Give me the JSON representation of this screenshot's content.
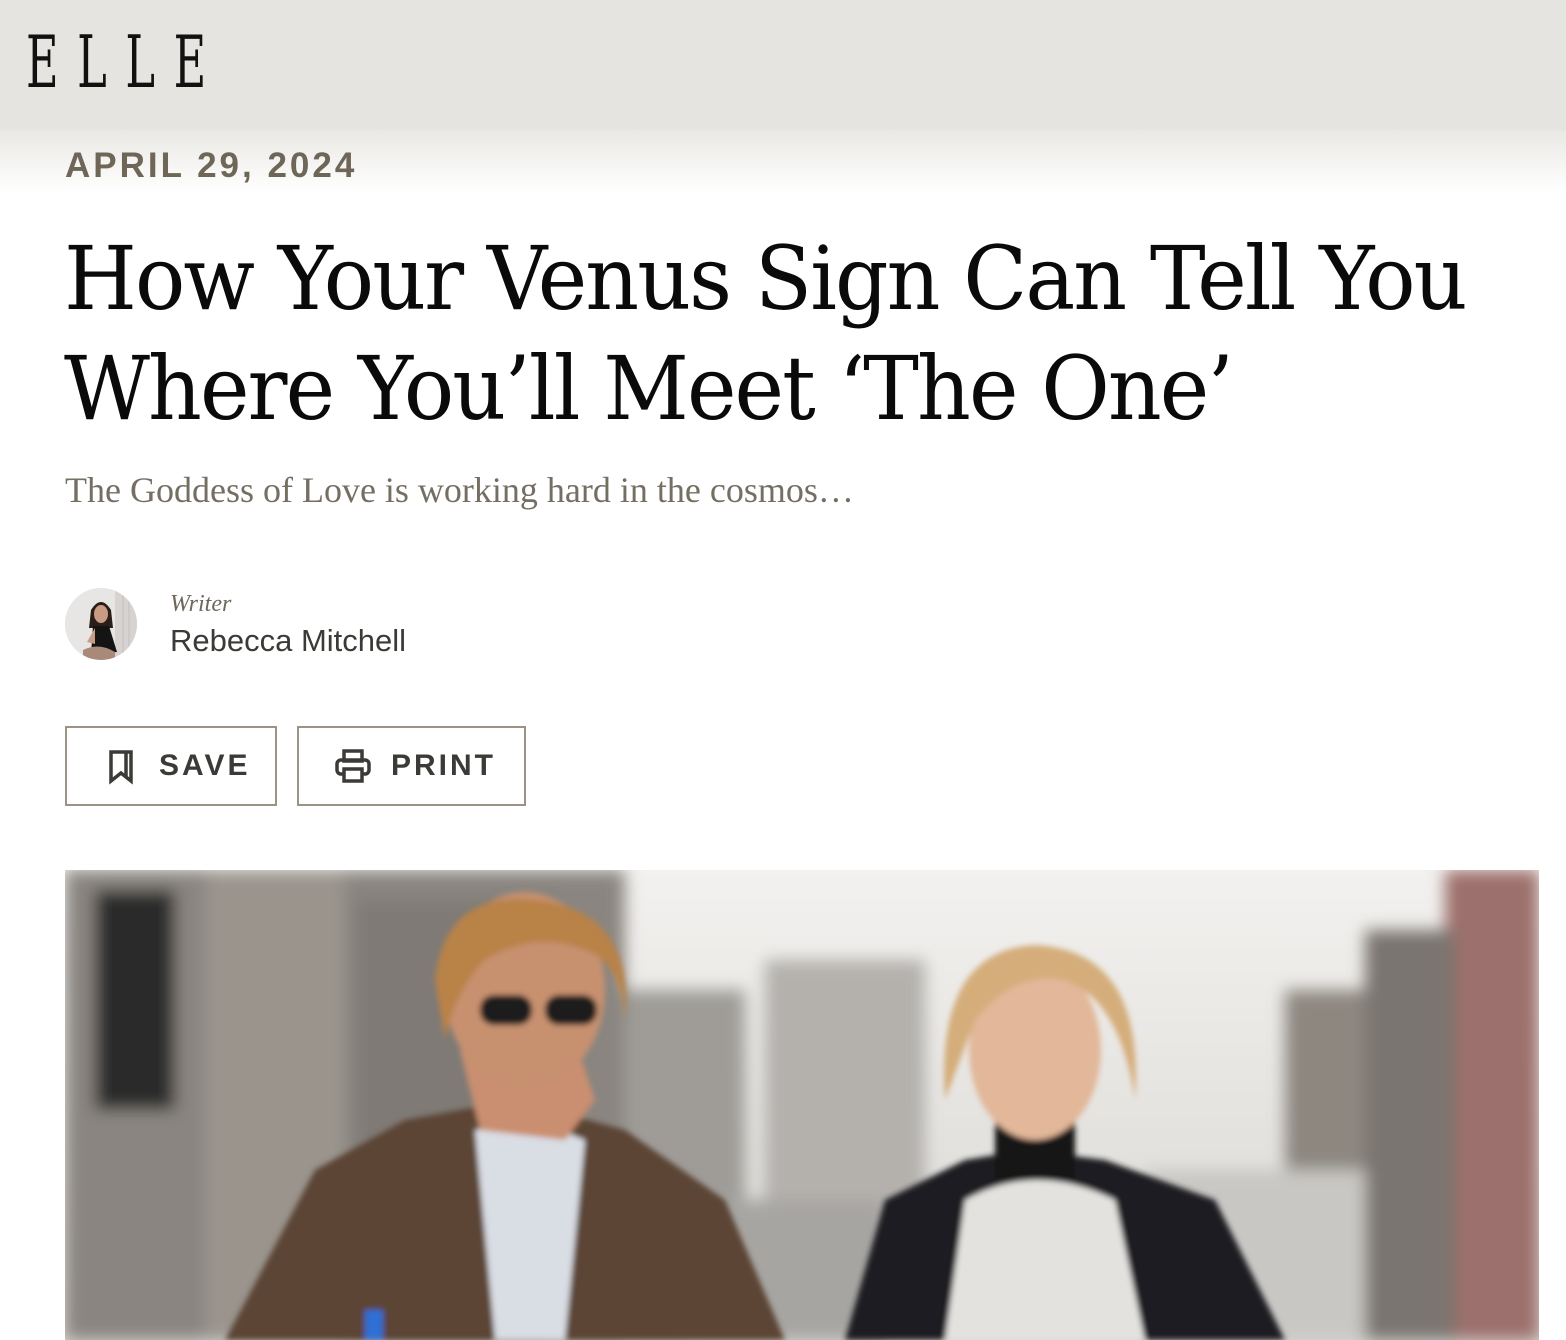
{
  "site": {
    "logo_text": "ELLE"
  },
  "article": {
    "date": "APRIL 29, 2024",
    "headline": "How Your Venus Sign Can Tell You Where You’ll Meet ‘The One’",
    "dek": "The Goddess of Love is working hard in the cosmos…",
    "byline": {
      "role": "Writer",
      "author": "Rebecca Mitchell"
    }
  },
  "actions": {
    "save_label": "SAVE",
    "save_icon": "bookmark-icon",
    "print_label": "PRINT",
    "print_icon": "printer-icon"
  },
  "colors": {
    "header_bg": "#e5e4e0",
    "date_text": "#6e6657",
    "dek_text": "#756f63",
    "button_border": "#9b9385"
  }
}
